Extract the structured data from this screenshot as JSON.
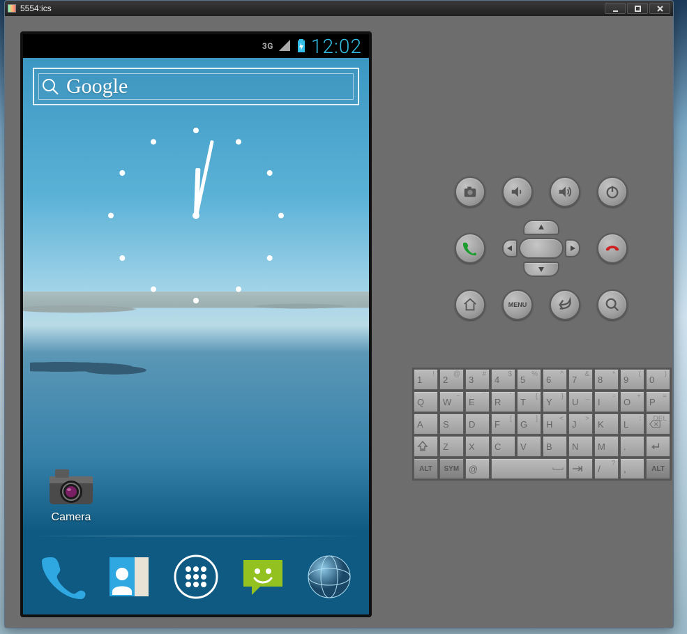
{
  "window": {
    "title": "5554:ics"
  },
  "statusbar": {
    "signal_type": "3G",
    "time": "12:02"
  },
  "search": {
    "label": "Google"
  },
  "homescreen": {
    "shortcut1_label": "Camera"
  },
  "dock": {
    "phone": "Phone",
    "contacts": "Contacts",
    "apps": "Apps",
    "messaging": "Messaging",
    "browser": "Browser"
  },
  "hw": {
    "camera": "camera",
    "vol_down": "volume-down",
    "vol_up": "volume-up",
    "power": "power",
    "call": "call",
    "end": "end-call",
    "home": "home",
    "menu": "MENU",
    "back": "back",
    "search": "search"
  },
  "keyboard": {
    "row1": [
      {
        "m": "1",
        "s": "!"
      },
      {
        "m": "2",
        "s": "@"
      },
      {
        "m": "3",
        "s": "#"
      },
      {
        "m": "4",
        "s": "$"
      },
      {
        "m": "5",
        "s": "%"
      },
      {
        "m": "6",
        "s": "^"
      },
      {
        "m": "7",
        "s": "&"
      },
      {
        "m": "8",
        "s": "*"
      },
      {
        "m": "9",
        "s": "("
      },
      {
        "m": "0",
        "s": ")"
      }
    ],
    "row2": [
      {
        "m": "Q"
      },
      {
        "m": "W",
        "s": "~"
      },
      {
        "m": "E",
        "s": "¯"
      },
      {
        "m": "R",
        "s": "`"
      },
      {
        "m": "T",
        "s": "{"
      },
      {
        "m": "Y",
        "s": "}"
      },
      {
        "m": "U",
        "s": "_"
      },
      {
        "m": "I",
        "s": "-"
      },
      {
        "m": "O",
        "s": "+"
      },
      {
        "m": "P",
        "s": "="
      }
    ],
    "row3": [
      {
        "m": "A"
      },
      {
        "m": "S"
      },
      {
        "m": "D"
      },
      {
        "m": "F",
        "s": "["
      },
      {
        "m": "G",
        "s": "]"
      },
      {
        "m": "H",
        "s": "<"
      },
      {
        "m": "J",
        "s": ">"
      },
      {
        "m": "K",
        ";": ";"
      },
      {
        "m": "L",
        "s": ":"
      }
    ],
    "row4": [
      {
        "m": "Z"
      },
      {
        "m": "X"
      },
      {
        "m": "C"
      },
      {
        "m": "V"
      },
      {
        "m": "B"
      },
      {
        "m": "N"
      },
      {
        "m": "M"
      },
      {
        "m": ".",
        ",": ""
      }
    ],
    "row5": {
      "alt": "ALT",
      "sym": "SYM",
      "at": "@",
      "comma": ",",
      "slash": "/",
      "q": "?"
    },
    "del": "DEL"
  }
}
